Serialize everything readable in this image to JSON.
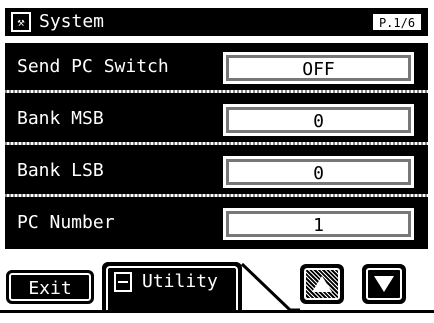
{
  "header": {
    "title": "System",
    "icon": "tools-icon",
    "page": "P.1/6"
  },
  "params": [
    {
      "label": "Send PC Switch",
      "value": "OFF"
    },
    {
      "label": "Bank MSB",
      "value": "0"
    },
    {
      "label": "Bank LSB",
      "value": "0"
    },
    {
      "label": "PC Number",
      "value": "1"
    }
  ],
  "footer": {
    "exit_label": "Exit",
    "utility_label": "Utility",
    "utility_icon": "utility-icon",
    "up_icon": "arrow-up-icon",
    "down_icon": "arrow-down-icon"
  },
  "colors": {
    "background": "#000000",
    "foreground": "#ffffff"
  }
}
